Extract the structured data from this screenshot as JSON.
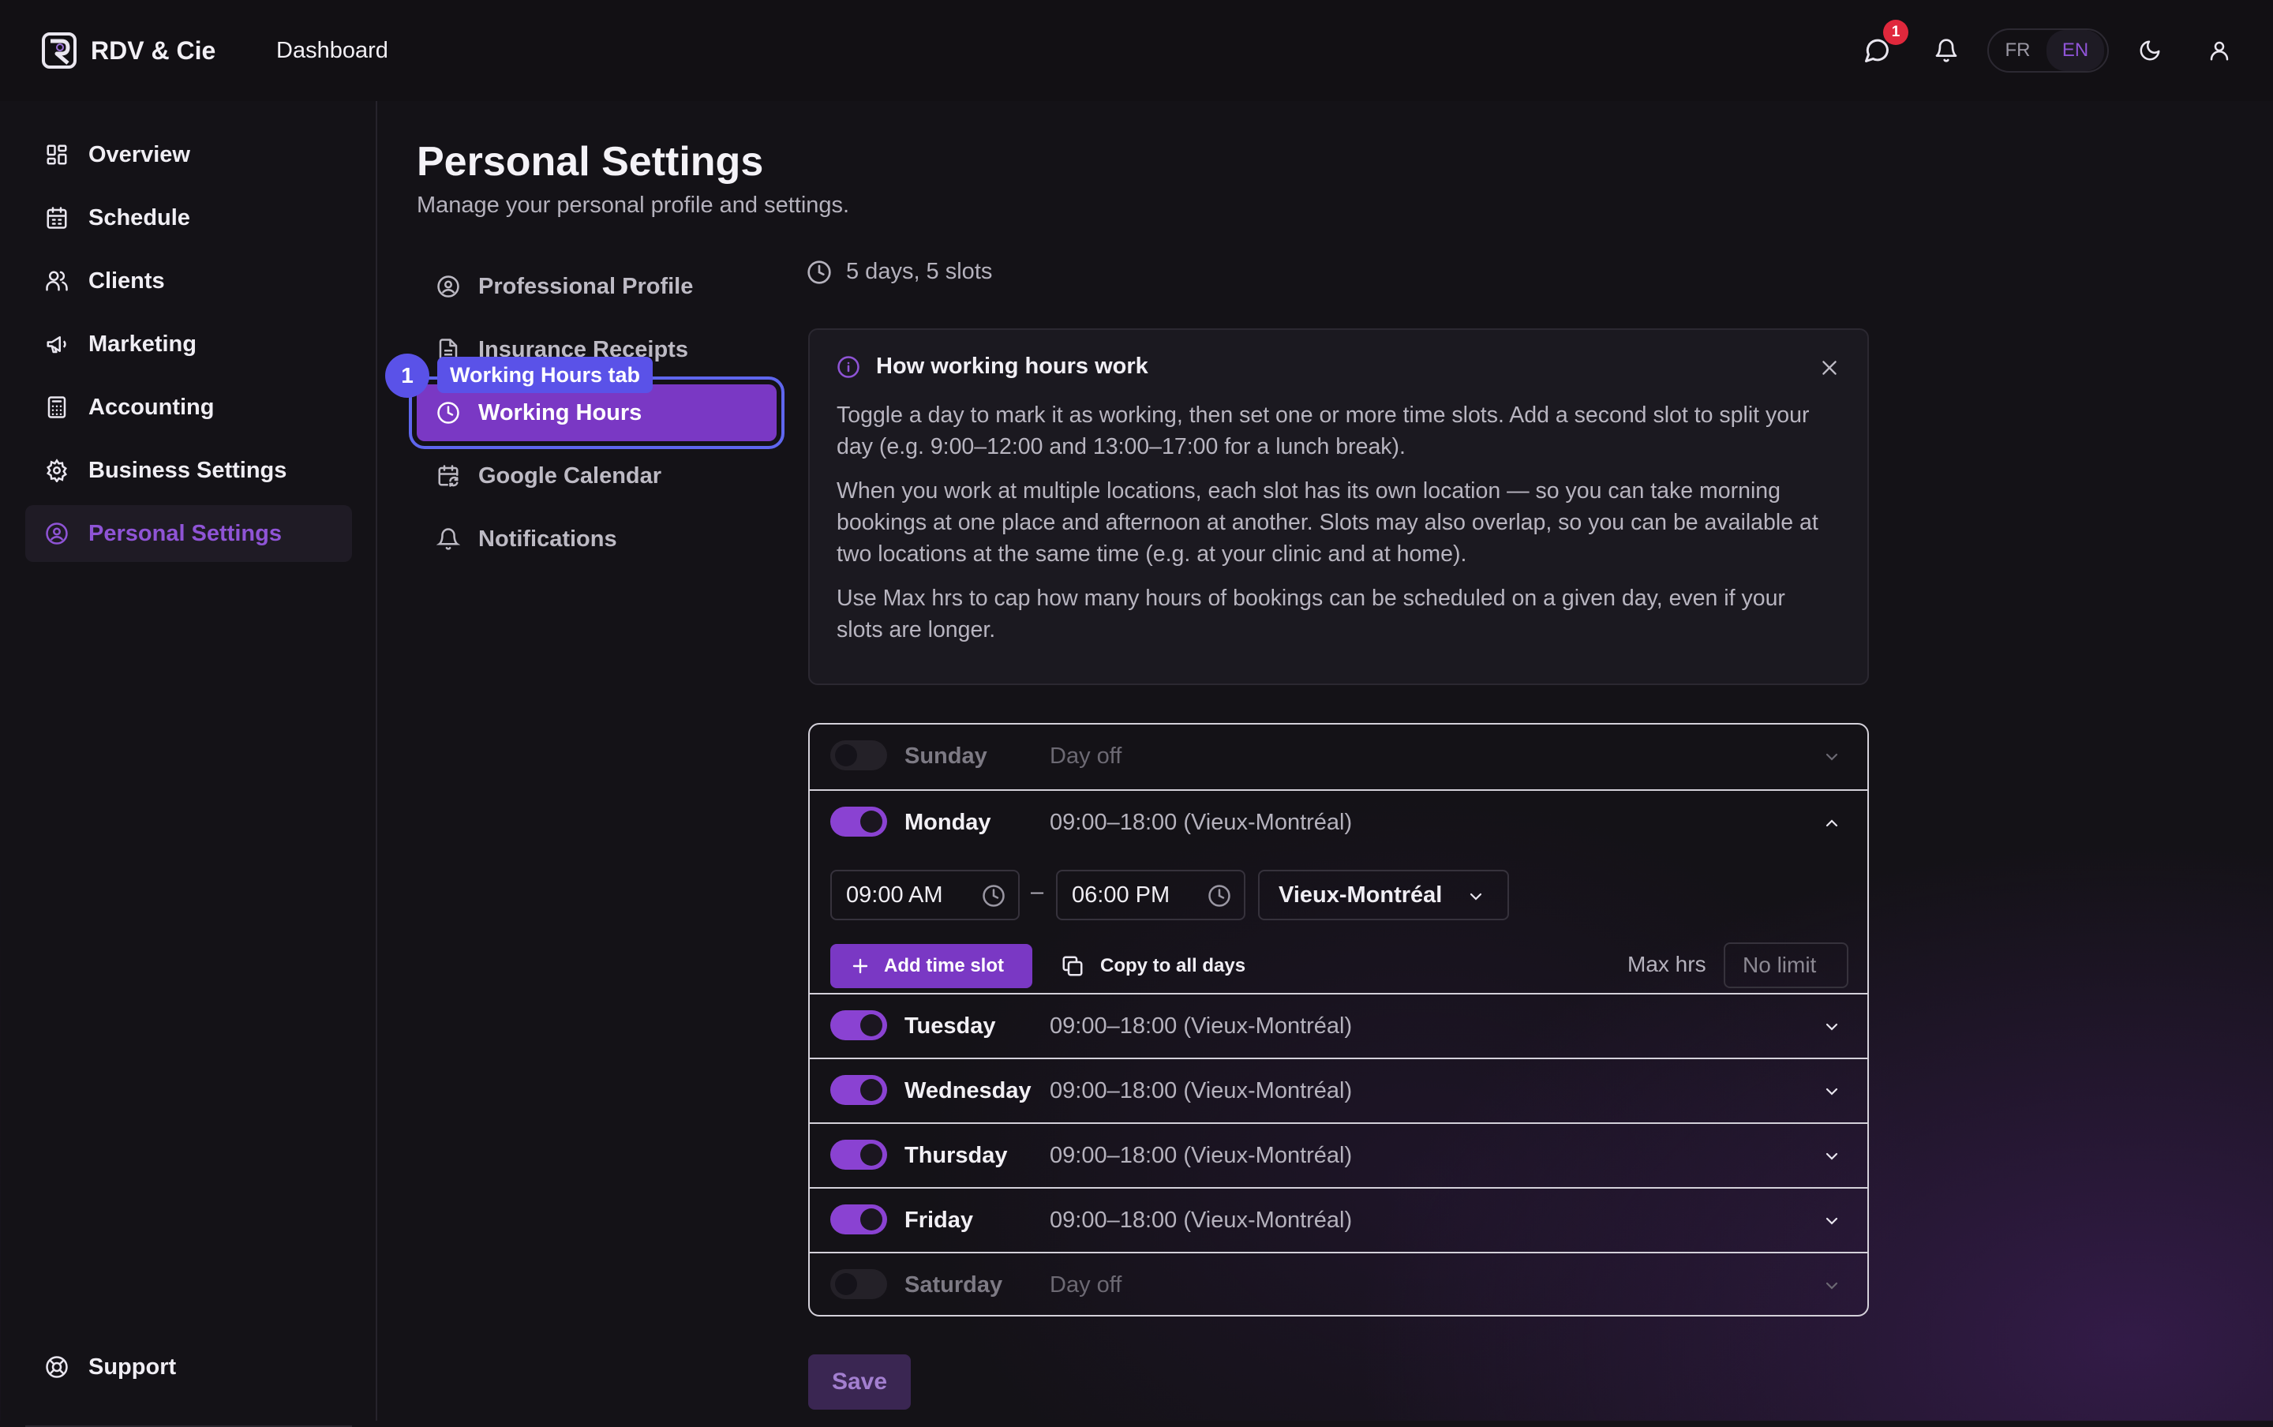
{
  "header": {
    "brand": "RDV & Cie",
    "dashboard_link": "Dashboard",
    "messages_badge": "1",
    "lang_fr": "FR",
    "lang_en": "EN",
    "active_language": "EN"
  },
  "sidebar": {
    "items": [
      {
        "label": "Overview",
        "icon": "grid-icon"
      },
      {
        "label": "Schedule",
        "icon": "calendar-icon"
      },
      {
        "label": "Clients",
        "icon": "users-icon"
      },
      {
        "label": "Marketing",
        "icon": "megaphone-icon"
      },
      {
        "label": "Accounting",
        "icon": "calculator-icon"
      },
      {
        "label": "Business Settings",
        "icon": "gear-icon"
      },
      {
        "label": "Personal Settings",
        "icon": "user-circle-icon"
      }
    ],
    "active": "Personal Settings",
    "support": "Support"
  },
  "page": {
    "title": "Personal Settings",
    "subtitle": "Manage your personal profile and settings."
  },
  "settings_nav": {
    "items": [
      {
        "label": "Professional Profile",
        "icon": "user-circle-icon"
      },
      {
        "label": "Insurance Receipts",
        "icon": "document-icon"
      },
      {
        "label": "Working Hours",
        "icon": "clock-icon"
      },
      {
        "label": "Google Calendar",
        "icon": "calendar-sync-icon"
      },
      {
        "label": "Notifications",
        "icon": "bell-icon"
      }
    ],
    "active": "Working Hours"
  },
  "tooltip": {
    "number": "1",
    "label": "Working Hours tab"
  },
  "summary": "5 days, 5 slots",
  "info": {
    "title": "How working hours work",
    "p1": "Toggle a day to mark it as working, then set one or more time slots. Add a second slot to split your day (e.g. 9:00–12:00 and 13:00–17:00 for a lunch break).",
    "p2": "When you work at multiple locations, each slot has its own location — so you can take morning bookings at one place and afternoon at another. Slots may also overlap, so you can be available at two locations at the same time (e.g. at your clinic and at home).",
    "p3": "Use Max hrs to cap how many hours of bookings can be scheduled on a given day, even if your slots are longer."
  },
  "days": [
    {
      "name": "Sunday",
      "summary": "Day off",
      "enabled": false,
      "expanded": false
    },
    {
      "name": "Monday",
      "summary": "09:00–18:00 (Vieux-Montréal)",
      "enabled": true,
      "expanded": true
    },
    {
      "name": "Tuesday",
      "summary": "09:00–18:00 (Vieux-Montréal)",
      "enabled": true,
      "expanded": false
    },
    {
      "name": "Wednesday",
      "summary": "09:00–18:00 (Vieux-Montréal)",
      "enabled": true,
      "expanded": false
    },
    {
      "name": "Thursday",
      "summary": "09:00–18:00 (Vieux-Montréal)",
      "enabled": true,
      "expanded": false
    },
    {
      "name": "Friday",
      "summary": "09:00–18:00 (Vieux-Montréal)",
      "enabled": true,
      "expanded": false
    },
    {
      "name": "Saturday",
      "summary": "Day off",
      "enabled": false,
      "expanded": false
    }
  ],
  "monday_slot": {
    "start": "09:00 AM",
    "separator": "–",
    "end": "06:00 PM",
    "location": "Vieux-Montréal",
    "add_slot": "Add time slot",
    "copy_all": "Copy to all days",
    "max_hrs_label": "Max hrs",
    "max_hrs_placeholder": "No limit"
  },
  "save": "Save",
  "colors": {
    "accent": "#7a38c4",
    "accent_text": "#8f54d6",
    "tooltip": "#5a52e8",
    "badge": "#e0283c",
    "background": "#141217"
  }
}
